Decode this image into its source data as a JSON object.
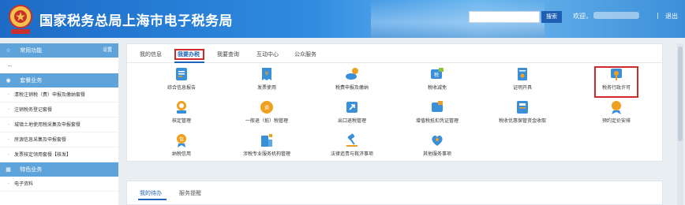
{
  "header": {
    "title": "国家税务总局上海市电子税务局",
    "search_button": "搜索",
    "welcome": "欢迎，",
    "separator": "|",
    "logout": "退出"
  },
  "sidebar": {
    "common_functions": {
      "label": "常用功能",
      "setting": "设置"
    },
    "blank_item": "--",
    "package_business": {
      "label": "套餐业务"
    },
    "package_items": [
      "清税注销税（费）申报及缴纳套餐",
      "注销税务登记套餐",
      "城镇土地使用税采集及申报套餐",
      "房源信息采集及申报套餐",
      "发票核定领用套餐【核发】"
    ],
    "special_business": {
      "label": "特色业务"
    },
    "special_items": [
      "电子资料"
    ]
  },
  "main": {
    "tabs": [
      "我的信息",
      "我要办税",
      "我要查询",
      "互动中心",
      "公众服务"
    ],
    "active_tab": "我要办税",
    "services": [
      {
        "label": "综合信息报告",
        "icon": "document-report-icon"
      },
      {
        "label": "发票使用",
        "icon": "invoice-icon"
      },
      {
        "label": "税费申报及缴纳",
        "icon": "tax-payment-icon"
      },
      {
        "label": "税收减免",
        "icon": "tax-relief-icon"
      },
      {
        "label": "证明开具",
        "icon": "certificate-icon"
      },
      {
        "label": "税务行政许可",
        "icon": "administrative-license-icon"
      },
      {
        "label": "核定管理",
        "icon": "verification-icon"
      },
      {
        "label": "一般退（抵）税管理",
        "icon": "tax-refund-icon"
      },
      {
        "label": "出口退税管理",
        "icon": "export-refund-icon"
      },
      {
        "label": "增值税抵扣凭证管理",
        "icon": "vat-deduction-icon"
      },
      {
        "label": "税收优惠保管资金收取",
        "icon": "fund-collection-icon"
      },
      {
        "label": "预约定价安排",
        "icon": "pricing-arrangement-icon"
      },
      {
        "label": "纳税信用",
        "icon": "tax-credit-icon"
      },
      {
        "label": "涉税专业服务机构管理",
        "icon": "service-agency-icon"
      },
      {
        "label": "法律追责与救济事项",
        "icon": "legal-hammer-icon"
      },
      {
        "label": "其他服务事项",
        "icon": "other-services-icon"
      }
    ],
    "highlighted_service": "税务行政许可"
  },
  "bottom": {
    "tabs": [
      "我的待办",
      "服务提醒"
    ],
    "active_tab": "我的待办"
  },
  "colors": {
    "header_blue": "#1d6bc6",
    "sidebar_head": "#5ea3d9",
    "active_blue": "#1f64b8",
    "highlight_red": "#d0292b",
    "icon_blue": "#3a8fd9",
    "icon_orange": "#f0a020"
  }
}
